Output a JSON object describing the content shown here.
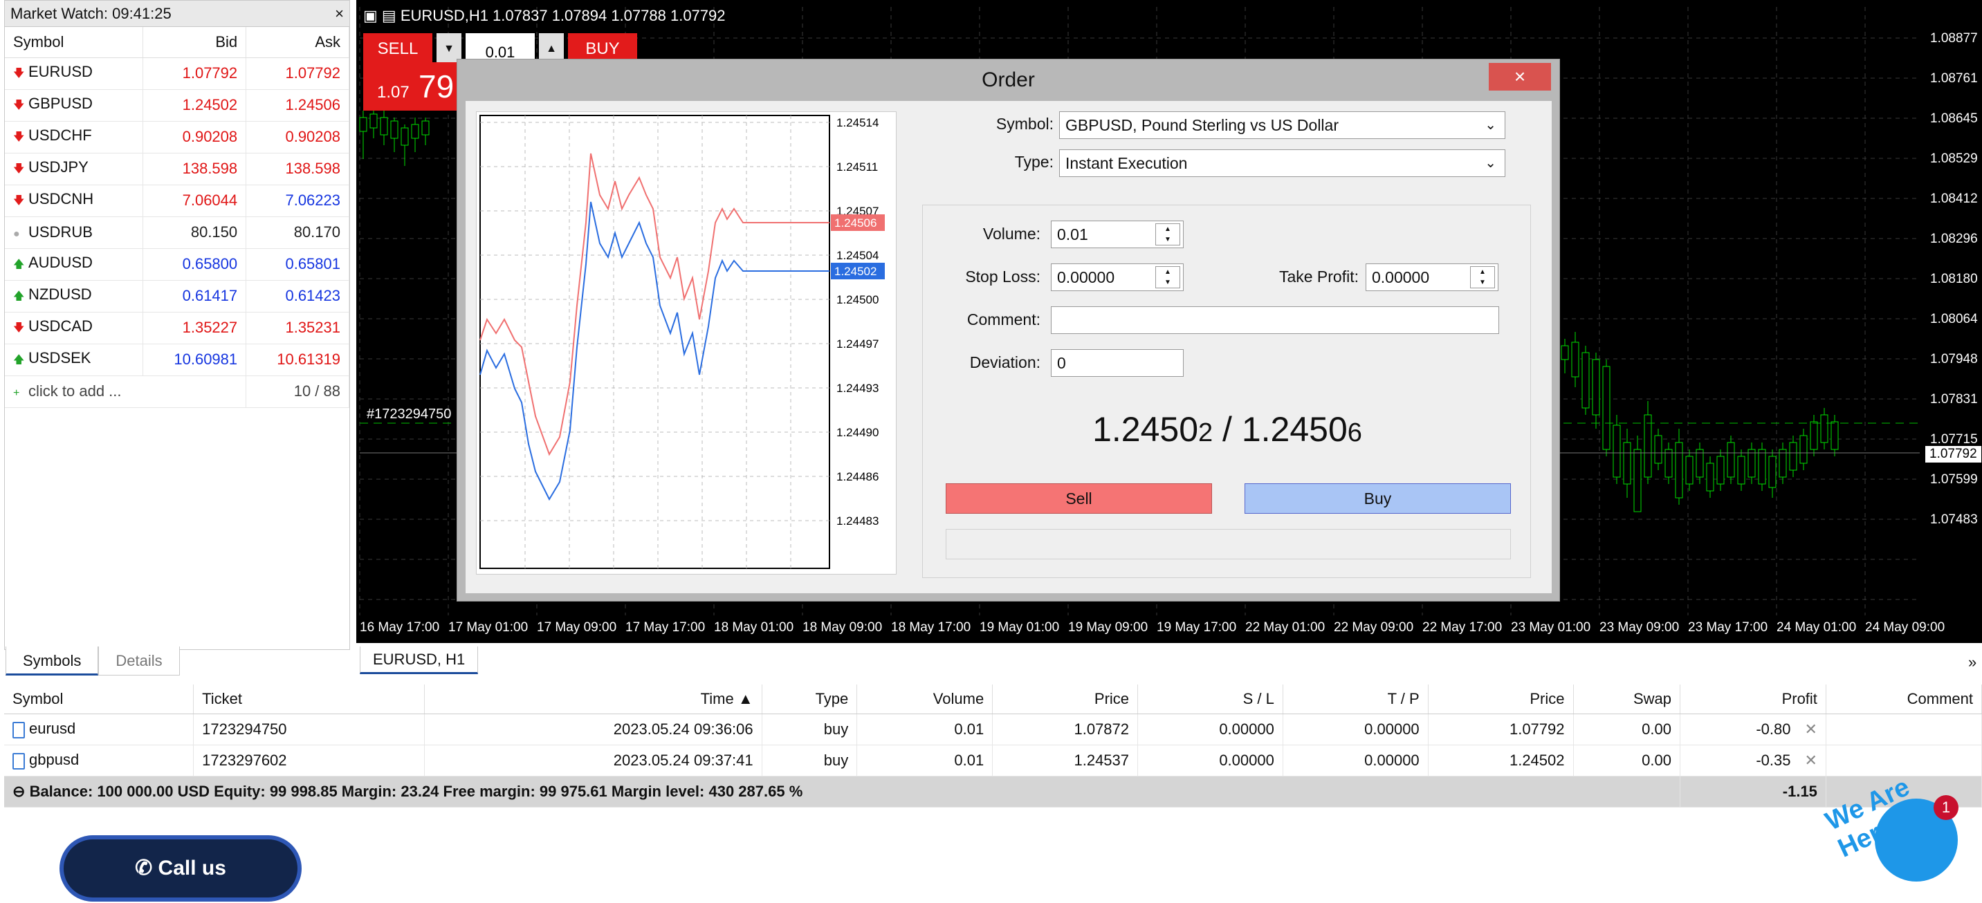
{
  "market_watch": {
    "title": "Market Watch: 09:41:25",
    "columns": [
      "Symbol",
      "Bid",
      "Ask"
    ],
    "rows": [
      {
        "symbol": "EURUSD",
        "bid": "1.07792",
        "ask": "1.07792",
        "dir": "down",
        "bid_color": "red",
        "ask_color": "red"
      },
      {
        "symbol": "GBPUSD",
        "bid": "1.24502",
        "ask": "1.24506",
        "dir": "down",
        "bid_color": "red",
        "ask_color": "red"
      },
      {
        "symbol": "USDCHF",
        "bid": "0.90208",
        "ask": "0.90208",
        "dir": "down",
        "bid_color": "red",
        "ask_color": "red"
      },
      {
        "symbol": "USDJPY",
        "bid": "138.598",
        "ask": "138.598",
        "dir": "down",
        "bid_color": "red",
        "ask_color": "red"
      },
      {
        "symbol": "USDCNH",
        "bid": "7.06044",
        "ask": "7.06223",
        "dir": "down",
        "bid_color": "red",
        "ask_color": "blue"
      },
      {
        "symbol": "USDRUB",
        "bid": "80.150",
        "ask": "80.170",
        "dir": "flat",
        "bid_color": "black",
        "ask_color": "black"
      },
      {
        "symbol": "AUDUSD",
        "bid": "0.65800",
        "ask": "0.65801",
        "dir": "up",
        "bid_color": "blue",
        "ask_color": "blue"
      },
      {
        "symbol": "NZDUSD",
        "bid": "0.61417",
        "ask": "0.61423",
        "dir": "up",
        "bid_color": "blue",
        "ask_color": "blue"
      },
      {
        "symbol": "USDCAD",
        "bid": "1.35227",
        "ask": "1.35231",
        "dir": "down",
        "bid_color": "red",
        "ask_color": "red"
      },
      {
        "symbol": "USDSEK",
        "bid": "10.60981",
        "ask": "10.61319",
        "dir": "up",
        "bid_color": "blue",
        "ask_color": "red"
      }
    ],
    "add_label": "click to add ...",
    "count": "10 / 88",
    "tabs": [
      "Symbols",
      "Details"
    ]
  },
  "chart": {
    "header": "EURUSD,H1  1.07837 1.07894 1.07788 1.07792",
    "sell_label": "SELL",
    "buy_label": "BUY",
    "volume": "0.01",
    "sell_price_small": "1.07",
    "sell_price_big": "79",
    "ticket_label": "#1723294750",
    "current_price": "1.07792",
    "price_ticks": [
      "1.08877",
      "1.08761",
      "1.08645",
      "1.08529",
      "1.08412",
      "1.08296",
      "1.08180",
      "1.08064",
      "1.07948",
      "1.07831",
      "1.07715",
      "1.07599",
      "1.07483"
    ],
    "time_ticks": [
      "16 May 17:00",
      "17 May 01:00",
      "17 May 09:00",
      "17 May 17:00",
      "18 May 01:00",
      "18 May 09:00",
      "18 May 17:00",
      "19 May 01:00",
      "19 May 09:00",
      "19 May 17:00",
      "22 May 01:00",
      "22 May 09:00",
      "22 May 17:00",
      "23 May 01:00",
      "23 May 09:00",
      "23 May 17:00",
      "24 May 01:00",
      "24 May 09:00"
    ],
    "tab": "EURUSD, H1",
    "colors": {
      "bg": "#000000",
      "bull": "#ffffff",
      "bear": "#00e000",
      "grid": "#2a2a2a"
    }
  },
  "order": {
    "title": "Order",
    "close": "×",
    "symbol_label": "Symbol:",
    "symbol_value": "GBPUSD, Pound Sterling vs US Dollar",
    "type_label": "Type:",
    "type_value": "Instant Execution",
    "volume_label": "Volume:",
    "volume_value": "0.01",
    "sl_label": "Stop Loss:",
    "sl_value": "0.00000",
    "tp_label": "Take Profit:",
    "tp_value": "0.00000",
    "comment_label": "Comment:",
    "comment_value": "",
    "deviation_label": "Deviation:",
    "deviation_value": "0",
    "quote_bid_main": "1.2450",
    "quote_bid_small": "2",
    "quote_sep": " / ",
    "quote_ask_main": "1.2450",
    "quote_ask_small": "6",
    "sell_label": "Sell",
    "buy_label": "Buy",
    "mini_chart": {
      "price_ticks": [
        "1.24514",
        "1.24511",
        "1.24507",
        "1.24504",
        "1.24500",
        "1.24497",
        "1.24493",
        "1.24490",
        "1.24486",
        "1.24483"
      ],
      "ask_label": "1.24506",
      "bid_label": "1.24502",
      "ask_color": "#f07070",
      "bid_color": "#2a6de0"
    }
  },
  "trade": {
    "columns": [
      "Symbol",
      "Ticket",
      "Time ▲",
      "Type",
      "Volume",
      "Price",
      "S / L",
      "T / P",
      "Price",
      "Swap",
      "Profit",
      "Comment"
    ],
    "rows": [
      [
        "eurusd",
        "1723294750",
        "2023.05.24 09:36:06",
        "buy",
        "0.01",
        "1.07872",
        "0.00000",
        "0.00000",
        "1.07792",
        "0.00",
        "-0.80",
        ""
      ],
      [
        "gbpusd",
        "1723297602",
        "2023.05.24 09:37:41",
        "buy",
        "0.01",
        "1.24537",
        "0.00000",
        "0.00000",
        "1.24502",
        "0.00",
        "-0.35",
        ""
      ]
    ],
    "balance": "Balance: 100 000.00 USD  Equity: 99 998.85  Margin: 23.24  Free margin: 99 975.61  Margin level: 430 287.65 %",
    "total_profit": "-1.15"
  },
  "call_button": "Call us",
  "chat_badge": "1",
  "we_are_here": "We Are Here!"
}
